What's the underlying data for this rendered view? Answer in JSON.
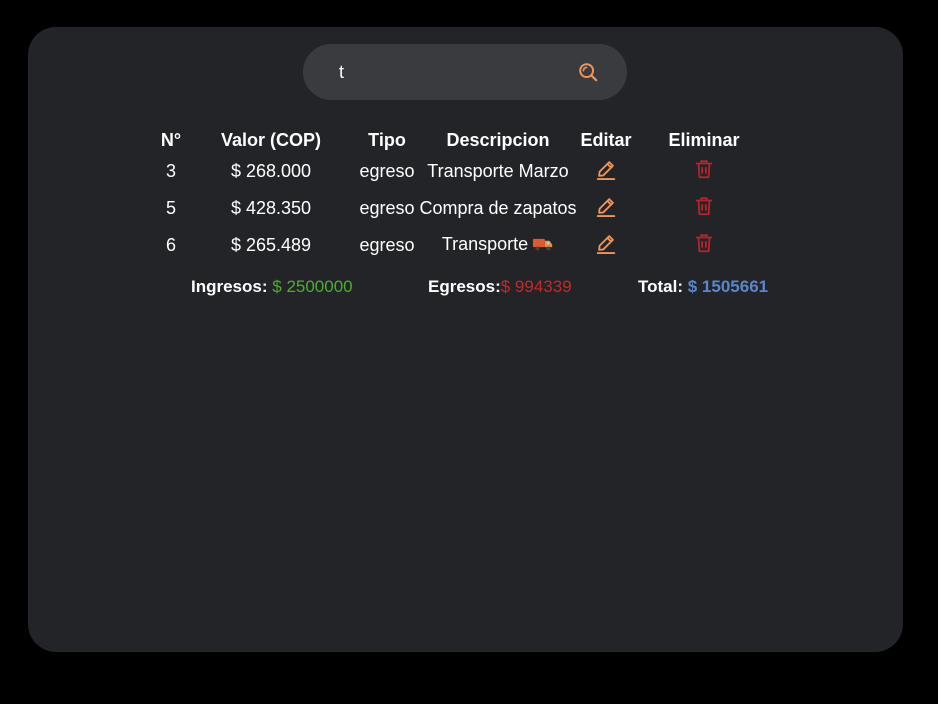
{
  "search": {
    "value": "t",
    "placeholder": ""
  },
  "table": {
    "headers": {
      "num": "N°",
      "valor": "Valor (COP)",
      "tipo": "Tipo",
      "descripcion": "Descripcion",
      "editar": "Editar",
      "eliminar": "Eliminar"
    },
    "rows": [
      {
        "num": "3",
        "valor": "$ 268.000",
        "tipo": "egreso",
        "descripcion": "Transporte Marzo"
      },
      {
        "num": "5",
        "valor": "$ 428.350",
        "tipo": "egreso",
        "descripcion": "Compra de zapatos"
      },
      {
        "num": "6",
        "valor": "$ 265.489",
        "tipo": "egreso",
        "descripcion": "Transporte"
      }
    ]
  },
  "totals": {
    "ingresos_label": "Ingresos:",
    "ingresos_value": "$ 2500000",
    "egresos_label": "Egresos:",
    "egresos_value": "$ 994339",
    "total_label": "Total:",
    "total_value": "$ 1505661"
  },
  "icons": {
    "search": "search-icon",
    "edit": "pencil-icon",
    "delete": "trash-icon",
    "truck": "truck-emoji-icon"
  },
  "colors": {
    "page_background": "#000000",
    "card_background": "#222428",
    "search_background": "#3a3b3f",
    "accent_orange": "#f0955a",
    "delete_red": "#b3262b",
    "ingresos_green": "#4caf2c",
    "egresos_red": "#c62828",
    "total_blue": "#5b86c9"
  }
}
